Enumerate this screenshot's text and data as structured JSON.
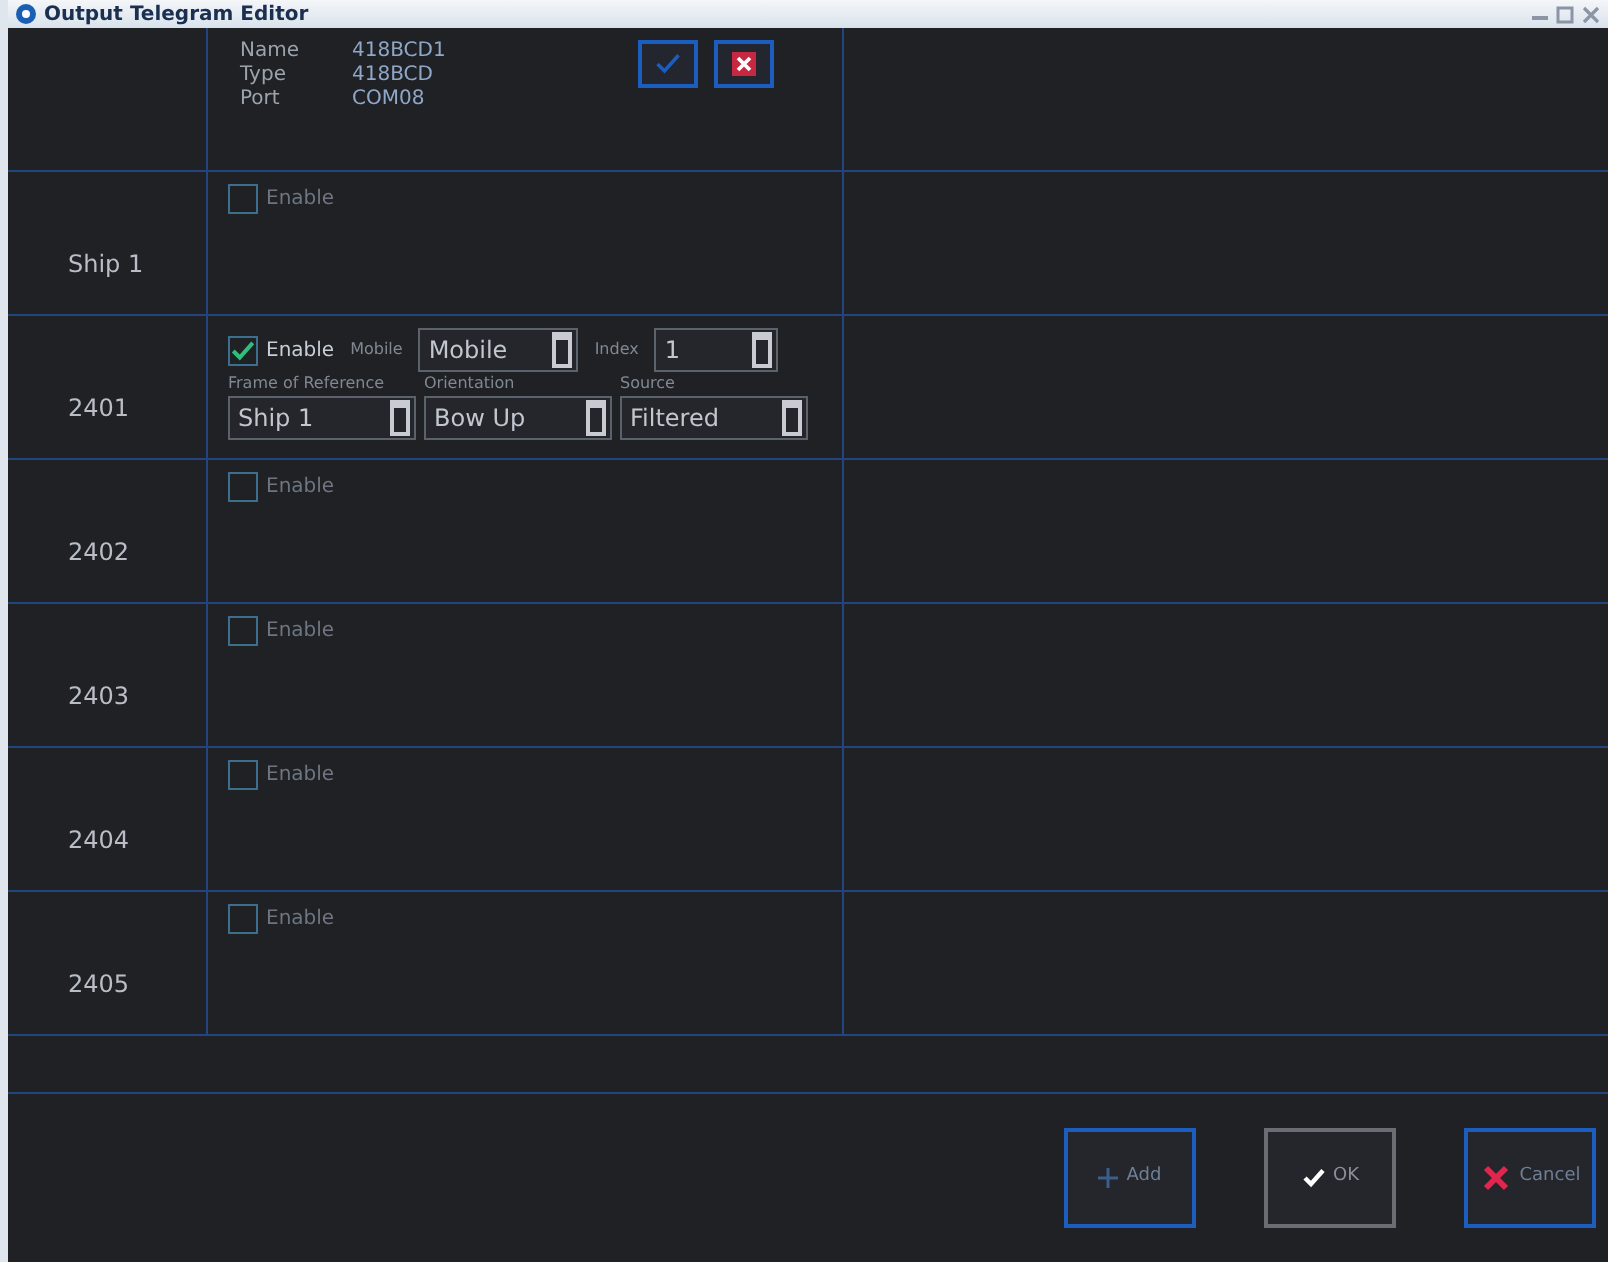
{
  "window": {
    "title": "Output Telegram Editor"
  },
  "header": {
    "fields": [
      {
        "label": "Name",
        "value": "418BCD1"
      },
      {
        "label": "Type",
        "value": "418BCD"
      },
      {
        "label": "Port",
        "value": "COM08"
      }
    ],
    "buttons": [
      {
        "kind": "confirm"
      },
      {
        "kind": "close"
      }
    ]
  },
  "rows": [
    {
      "label": "Ship 1",
      "enable": {
        "label": "Enable",
        "checked": false
      }
    },
    {
      "label": "2401",
      "enable": {
        "label": "Enable",
        "checked": true
      },
      "settings": [
        {
          "kind": "inline",
          "label": "Mobile",
          "value": "Mobile"
        },
        {
          "kind": "inline",
          "label": "Index",
          "value": "1"
        },
        {
          "kind": "stacked",
          "label": "Frame of Reference",
          "value": "Ship 1"
        },
        {
          "kind": "stacked",
          "label": "Orientation",
          "value": "Bow Up"
        },
        {
          "kind": "stacked",
          "label": "Source",
          "value": "Filtered"
        }
      ]
    },
    {
      "label": "2402",
      "enable": {
        "label": "Enable",
        "checked": false
      }
    },
    {
      "label": "2403",
      "enable": {
        "label": "Enable",
        "checked": false
      }
    },
    {
      "label": "2404",
      "enable": {
        "label": "Enable",
        "checked": false
      }
    },
    {
      "label": "2405",
      "enable": {
        "label": "Enable",
        "checked": false
      }
    }
  ],
  "footer_buttons": [
    {
      "kind": "add",
      "label": "Add"
    },
    {
      "kind": "ok",
      "label": "OK"
    },
    {
      "kind": "cancel",
      "label": "Cancel"
    }
  ]
}
